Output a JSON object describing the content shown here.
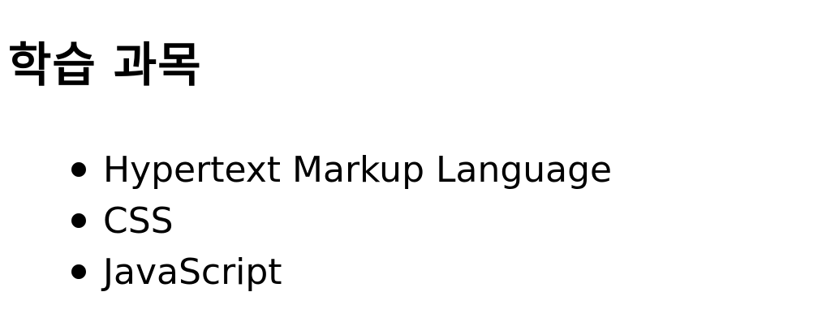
{
  "heading": "학습 과목",
  "subjects": [
    "Hypertext Markup Language",
    "CSS",
    "JavaScript"
  ]
}
